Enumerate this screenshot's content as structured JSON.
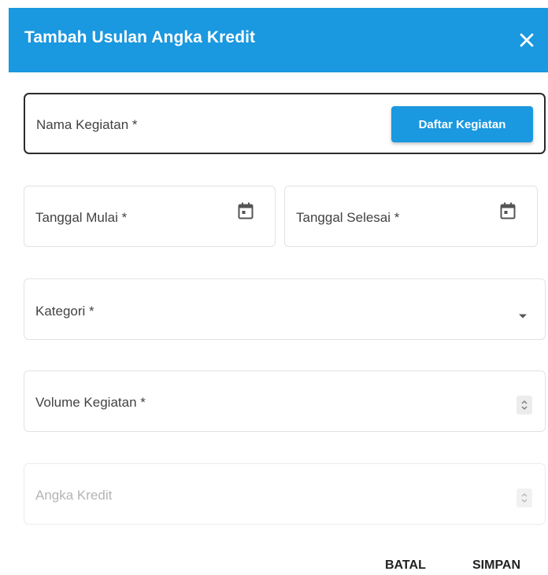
{
  "dialog": {
    "title": "Tambah Usulan Angka Kredit",
    "close_icon": "close-icon",
    "header_color": "#1a98e0"
  },
  "form": {
    "nama_kegiatan": {
      "label": "Nama Kegiatan *",
      "button": "Daftar Kegiatan"
    },
    "tanggal_mulai": {
      "label": "Tanggal Mulai *",
      "icon": "calendar-icon"
    },
    "tanggal_selesai": {
      "label": "Tanggal Selesai *",
      "icon": "calendar-icon"
    },
    "kategori": {
      "label": "Kategori *",
      "icon": "chevron-down-icon"
    },
    "volume_kegiatan": {
      "label": "Volume Kegiatan *",
      "icon": "spinner-icon"
    },
    "angka_kredit": {
      "label": "Angka Kredit",
      "disabled": true,
      "icon": "spinner-icon"
    }
  },
  "actions": {
    "cancel": "BATAL",
    "save": "SIMPAN"
  }
}
